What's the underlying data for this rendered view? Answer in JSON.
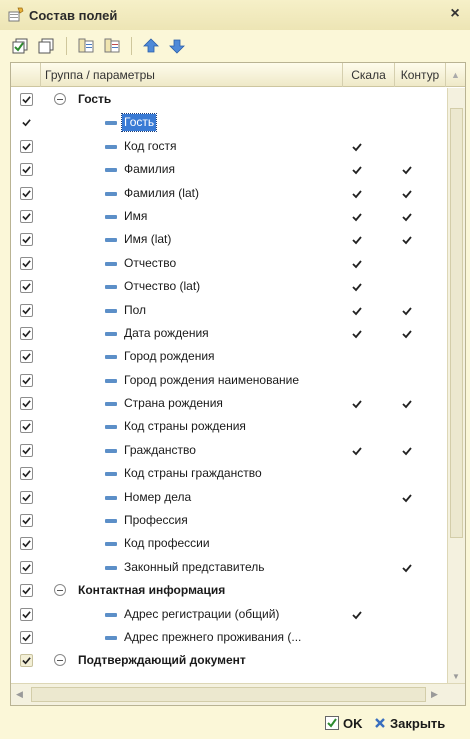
{
  "window": {
    "title": "Состав полей",
    "close_label": "×"
  },
  "toolbar": {
    "buttons": [
      "check-all-icon",
      "uncheck-all-icon",
      "copy-icon",
      "paste-icon",
      "move-up-icon",
      "move-down-icon"
    ]
  },
  "grid": {
    "columns": {
      "group": "Группа / параметры",
      "scale": "Скала",
      "contour": "Контур"
    },
    "rows": [
      {
        "type": "group",
        "label": "Гость",
        "checked": true,
        "checkbox": "box"
      },
      {
        "type": "field",
        "label": "Гость",
        "checked": true,
        "checkbox": "plain",
        "selected": true,
        "scale": false,
        "contour": false
      },
      {
        "type": "field",
        "label": "Код гостя",
        "checked": true,
        "scale": true,
        "contour": false
      },
      {
        "type": "field",
        "label": "Фамилия",
        "checked": true,
        "scale": true,
        "contour": true
      },
      {
        "type": "field",
        "label": "Фамилия (lat)",
        "checked": true,
        "scale": true,
        "contour": true
      },
      {
        "type": "field",
        "label": "Имя",
        "checked": true,
        "scale": true,
        "contour": true
      },
      {
        "type": "field",
        "label": "Имя (lat)",
        "checked": true,
        "scale": true,
        "contour": true
      },
      {
        "type": "field",
        "label": "Отчество",
        "checked": true,
        "scale": true,
        "contour": false
      },
      {
        "type": "field",
        "label": "Отчество (lat)",
        "checked": true,
        "scale": true,
        "contour": false
      },
      {
        "type": "field",
        "label": "Пол",
        "checked": true,
        "scale": true,
        "contour": true
      },
      {
        "type": "field",
        "label": "Дата рождения",
        "checked": true,
        "scale": true,
        "contour": true
      },
      {
        "type": "field",
        "label": "Город рождения",
        "checked": true,
        "scale": false,
        "contour": false
      },
      {
        "type": "field",
        "label": "Город рождения наименование",
        "checked": true,
        "scale": false,
        "contour": false
      },
      {
        "type": "field",
        "label": "Страна рождения",
        "checked": true,
        "scale": true,
        "contour": true
      },
      {
        "type": "field",
        "label": "Код страны рождения",
        "checked": true,
        "scale": false,
        "contour": false
      },
      {
        "type": "field",
        "label": "Гражданство",
        "checked": true,
        "scale": true,
        "contour": true
      },
      {
        "type": "field",
        "label": "Код страны гражданство",
        "checked": true,
        "scale": false,
        "contour": false
      },
      {
        "type": "field",
        "label": "Номер дела",
        "checked": true,
        "scale": false,
        "contour": true
      },
      {
        "type": "field",
        "label": "Профессия",
        "checked": true,
        "scale": false,
        "contour": false
      },
      {
        "type": "field",
        "label": "Код профессии",
        "checked": true,
        "scale": false,
        "contour": false
      },
      {
        "type": "field",
        "label": "Законный представитель",
        "checked": true,
        "scale": false,
        "contour": true
      },
      {
        "type": "group",
        "label": "Контактная информация",
        "checked": true,
        "checkbox": "box"
      },
      {
        "type": "field",
        "label": "Адрес регистрации (общий)",
        "checked": true,
        "scale": true,
        "contour": false
      },
      {
        "type": "field",
        "label": "Адрес прежнего проживания (...",
        "checked": true,
        "scale": false,
        "contour": false
      },
      {
        "type": "group",
        "label": "Подтверждающий документ",
        "checked": true,
        "checkbox": "dim"
      }
    ]
  },
  "footer": {
    "ok_label": "OK",
    "close_label": "Закрыть"
  },
  "colors": {
    "background": "#fbf7d8",
    "selection": "#3a7bd5",
    "field_marker": "#5c8fc8"
  }
}
